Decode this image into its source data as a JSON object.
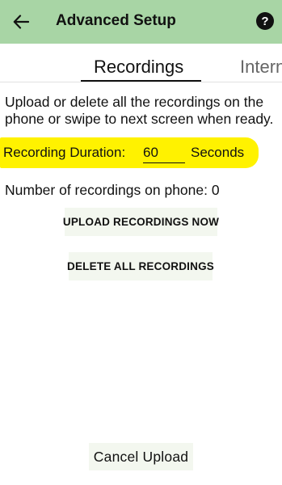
{
  "appbar": {
    "title": "Advanced Setup",
    "back_icon": "arrow-left-icon",
    "help_icon": "help-circle-icon",
    "help_glyph": "?"
  },
  "tabs": [
    {
      "label": "Recordings",
      "active": true
    },
    {
      "label": "Intern",
      "active": false
    }
  ],
  "intro_text": "Upload or delete all the recordings on the phone or swipe to next screen when ready.",
  "duration": {
    "label": "Recording Duration:",
    "value": "60",
    "unit": "Seconds",
    "highlight_color": "#fff200"
  },
  "count_text": "Number of recordings on phone: 0",
  "buttons": {
    "upload": "UPLOAD RECORDINGS NOW",
    "delete": "DELETE ALL RECORDINGS",
    "cancel": "Cancel Upload"
  },
  "colors": {
    "appbar": "#a8d5a5",
    "button_bg": "#f3f7ef"
  }
}
